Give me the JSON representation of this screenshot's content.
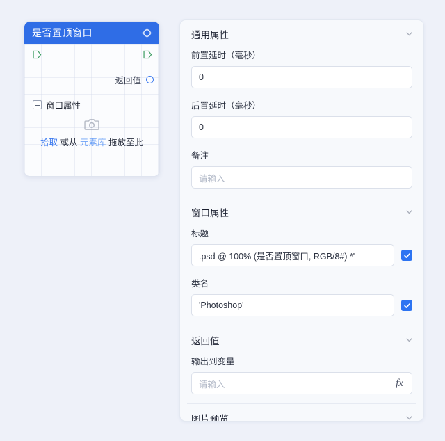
{
  "node": {
    "title": "是否置顶窗口",
    "header_icon": "crosshair-icon",
    "header_color": "#2f6de6",
    "return_label": "返回值",
    "attribute_label": "窗口属性",
    "dropzone": {
      "icon": "camera-icon",
      "pick_link": "拾取",
      "middle_text": "或从",
      "library_link": "元素库",
      "tail_text": "拖放至此"
    }
  },
  "panel": {
    "sections": [
      {
        "title": "通用属性",
        "chevron": "chevron-down-icon",
        "fields": [
          {
            "label": "前置延时（毫秒）",
            "value": "0",
            "placeholder": ""
          },
          {
            "label": "后置延时（毫秒）",
            "value": "0",
            "placeholder": ""
          },
          {
            "label": "备注",
            "value": "",
            "placeholder": "请输入"
          }
        ]
      },
      {
        "title": "窗口属性",
        "chevron": "chevron-down-icon",
        "fields": [
          {
            "label": "标题",
            "value": ".psd @ 100% (是否置顶窗口, RGB/8#) *'",
            "checked": true
          },
          {
            "label": "类名",
            "value": "'Photoshop'",
            "checked": true
          }
        ]
      },
      {
        "title": "返回值",
        "chevron": "chevron-down-icon",
        "fields": [
          {
            "label": "输出到变量",
            "value": "",
            "placeholder": "请输入",
            "fx_label": "fx"
          }
        ]
      },
      {
        "title": "图片预览",
        "chevron": "chevron-down-icon",
        "fields": []
      }
    ]
  },
  "colors": {
    "accent": "#2f6de6",
    "checkbox": "#2d74f2",
    "link": "#3d7bf0",
    "link_light": "#6fa3f7",
    "port_flow": "#3f9e63",
    "background": "#eef1f9"
  }
}
